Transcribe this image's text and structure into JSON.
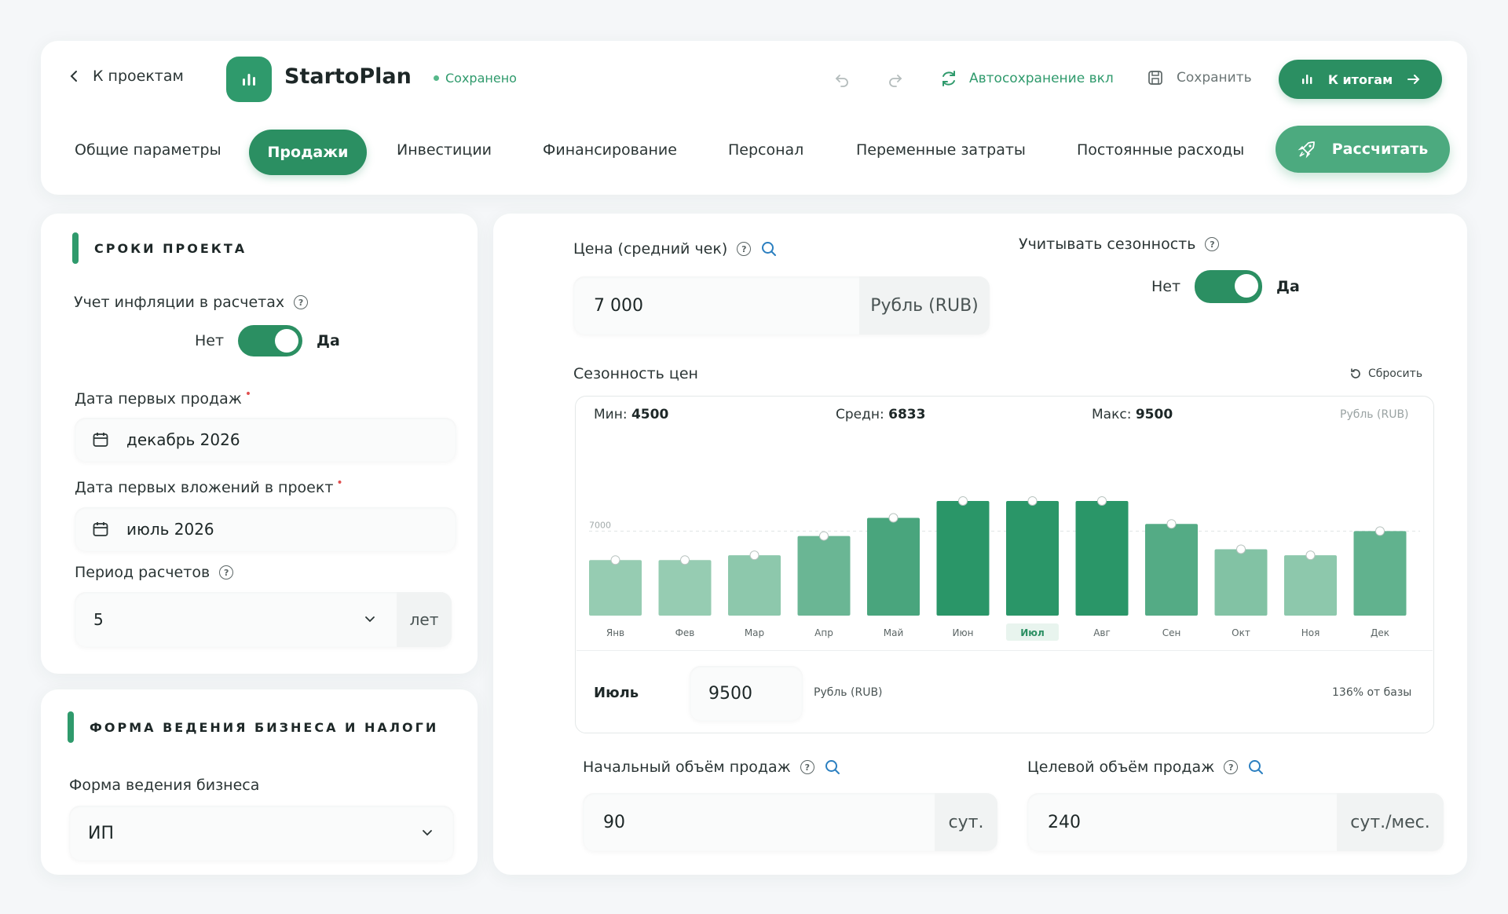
{
  "header": {
    "back_label": "К проектам",
    "brand": "StartoPlan",
    "status": "Сохранено",
    "autosave_label": "Автосохранение вкл",
    "save_label": "Сохранить",
    "totals_label": "К итогам",
    "accent_color": "#2b8f62"
  },
  "tabs": [
    {
      "label": "Общие параметры",
      "active": false
    },
    {
      "label": "Продажи",
      "active": true
    },
    {
      "label": "Инвестиции",
      "active": false
    },
    {
      "label": "Финансирование",
      "active": false
    },
    {
      "label": "Персонал",
      "active": false
    },
    {
      "label": "Переменные затраты",
      "active": false
    },
    {
      "label": "Постоянные расходы",
      "active": false
    }
  ],
  "calc_label": "Рассчитать",
  "project_terms": {
    "title": "СРОКИ ПРОЕКТА",
    "inflation_label": "Учет инфляции в расчетах",
    "toggle_no": "Нет",
    "toggle_yes": "Да",
    "inflation_on": true,
    "first_sales_label": "Дата первых продаж",
    "first_sales_value": "декабрь 2026",
    "first_invest_label": "Дата первых вложений в проект",
    "first_invest_value": "июль 2026",
    "period_label": "Период расчетов",
    "period_value": "5",
    "period_unit": "лет"
  },
  "business_form": {
    "title": "ФОРМА ВЕДЕНИЯ БИЗНЕСА И НАЛОГИ",
    "form_label": "Форма ведения бизнеса",
    "form_value": "ИП"
  },
  "price": {
    "label": "Цена (средний чек)",
    "value": "7 000",
    "currency": "Рубль (RUB)"
  },
  "seasonality": {
    "label": "Учитывать сезонность",
    "no": "Нет",
    "yes": "Да",
    "on": true,
    "chart_title": "Сезонность цен",
    "reset_label": "Сбросить",
    "min_label": "Мин:",
    "min_value": "4500",
    "avg_label": "Средн:",
    "avg_value": "6833",
    "max_label": "Макс:",
    "max_value": "9500",
    "currency": "Рубль (RUB)",
    "baseline_label": "7000",
    "selected_month": "Июль",
    "selected_value": "9500",
    "selected_currency": "Рубль (RUB)",
    "selected_pct": "136% от базы"
  },
  "chart_data": {
    "type": "bar",
    "categories": [
      "Янв",
      "Фев",
      "Мар",
      "Апр",
      "Май",
      "Июн",
      "Июл",
      "Авг",
      "Сен",
      "Окт",
      "Ноя",
      "Дек"
    ],
    "values": [
      4600,
      4600,
      5000,
      6600,
      8100,
      9500,
      9500,
      9500,
      7600,
      5500,
      5000,
      7000
    ],
    "baseline": 7000,
    "selected": "Июл",
    "ylim": [
      0,
      9500
    ]
  },
  "volume": {
    "start_label": "Начальный объём продаж",
    "start_value": "90",
    "start_unit": "сут.",
    "target_label": "Целевой объём продаж",
    "target_value": "240",
    "target_unit": "сут./мес."
  }
}
